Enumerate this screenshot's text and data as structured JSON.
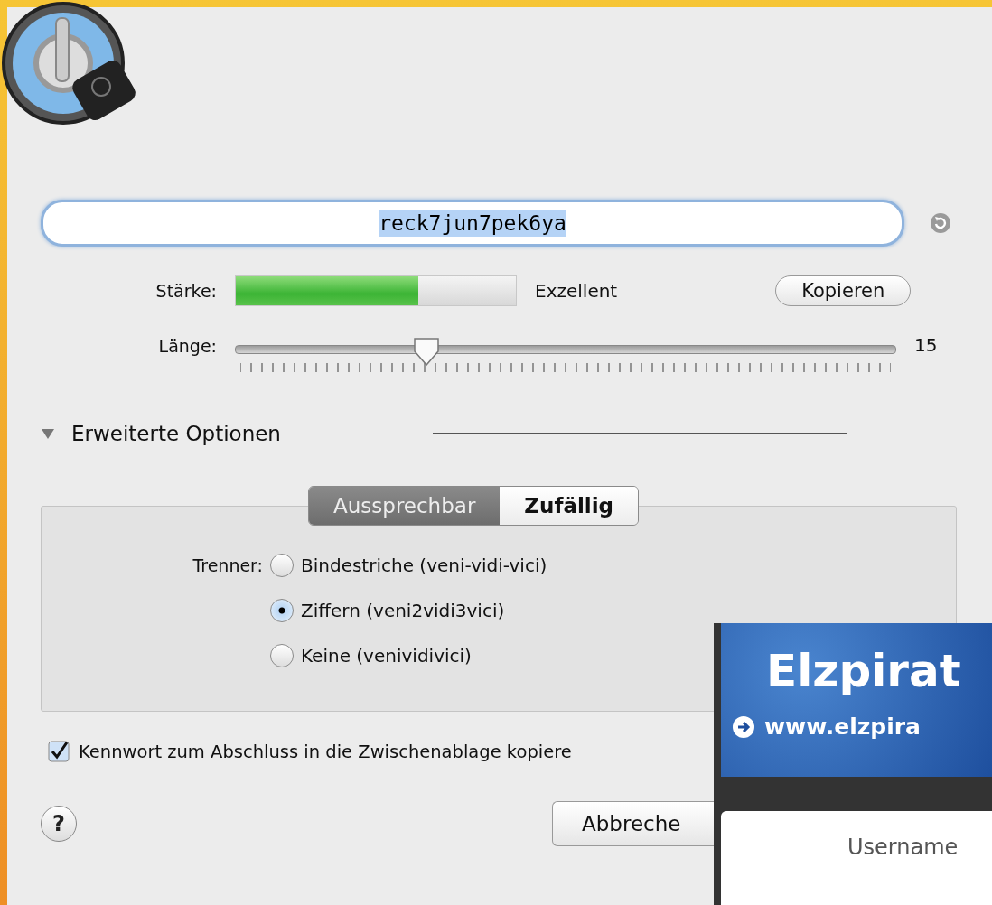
{
  "password": {
    "value": "reck7jun7pek6ya"
  },
  "strength": {
    "label": "Stärke:",
    "level": 0.65,
    "rating": "Exzellent"
  },
  "copy_button": "Kopieren",
  "length": {
    "label": "Länge:",
    "level": 0.29,
    "value": "15"
  },
  "advanced": {
    "label": "Erweiterte Optionen",
    "expanded": true
  },
  "modes": [
    {
      "label": "Aussprechbar",
      "selected": true
    },
    {
      "label": "Zufällig",
      "selected": false
    }
  ],
  "separator": {
    "label": "Trenner:",
    "options": [
      {
        "label": "Bindestriche (veni-vidi-vici)",
        "selected": false
      },
      {
        "label": "Ziffern (veni2vidi3vici)",
        "selected": true
      },
      {
        "label": "Keine (venividivici)",
        "selected": false
      }
    ]
  },
  "copy_on_finish": {
    "label": "Kennwort zum Abschluss in die Zwischenablage kopiere",
    "checked": true
  },
  "help_button": "?",
  "cancel_button": "Abbreche",
  "inset": {
    "title": "Elzpirat",
    "link": "www.elzpira",
    "field_label": "Username"
  }
}
